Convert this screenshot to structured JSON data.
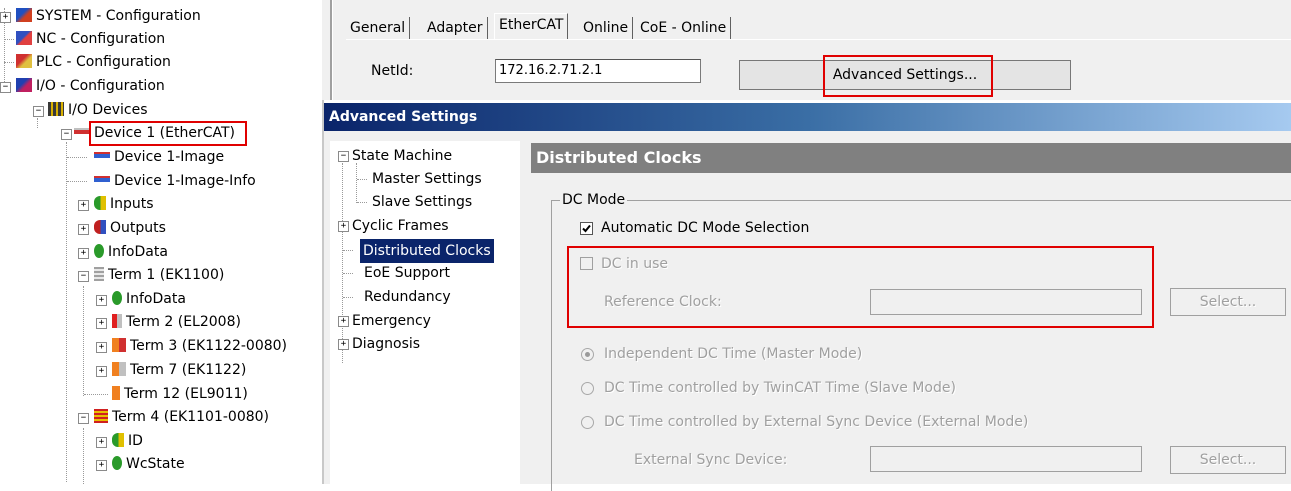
{
  "tree": {
    "items": [
      {
        "label": "SYSTEM - Configuration",
        "icon": "system-config-icon"
      },
      {
        "label": "NC - Configuration",
        "icon": "nc-config-icon"
      },
      {
        "label": "PLC - Configuration",
        "icon": "plc-config-icon"
      },
      {
        "label": "I/O - Configuration",
        "icon": "io-config-icon"
      },
      {
        "label": "I/O Devices",
        "icon": "io-devices-icon"
      },
      {
        "label": "Device 1 (EtherCAT)",
        "icon": "ethercat-device-icon"
      },
      {
        "label": "Device 1-Image",
        "icon": "image-icon"
      },
      {
        "label": "Device 1-Image-Info",
        "icon": "image-info-icon"
      },
      {
        "label": "Inputs",
        "icon": "inputs-icon"
      },
      {
        "label": "Outputs",
        "icon": "outputs-icon"
      },
      {
        "label": "InfoData",
        "icon": "infodata-icon"
      },
      {
        "label": "Term 1 (EK1100)",
        "icon": "terminal-icon"
      },
      {
        "label": "InfoData",
        "icon": "infodata-icon"
      },
      {
        "label": "Term 2 (EL2008)",
        "icon": "terminal-icon"
      },
      {
        "label": "Term 3 (EK1122-0080)",
        "icon": "terminal-icon"
      },
      {
        "label": "Term 7 (EK1122)",
        "icon": "terminal-icon"
      },
      {
        "label": "Term 12 (EL9011)",
        "icon": "terminal-icon"
      },
      {
        "label": "Term 4 (EK1101-0080)",
        "icon": "terminal-icon"
      },
      {
        "label": "ID",
        "icon": "id-icon"
      },
      {
        "label": "WcState",
        "icon": "wcstate-icon"
      }
    ]
  },
  "tabs": [
    "General",
    "Adapter",
    "EtherCAT",
    "Online",
    "CoE - Online"
  ],
  "active_tab": "EtherCAT",
  "netid": {
    "label": "NetId:",
    "value": "172.16.2.71.2.1"
  },
  "advanced_button": "Advanced Settings...",
  "dialog": {
    "title": "Advanced Settings",
    "nav": [
      {
        "label": "State Machine"
      },
      {
        "label": "Master Settings"
      },
      {
        "label": "Slave Settings"
      },
      {
        "label": "Cyclic Frames"
      },
      {
        "label": "Distributed Clocks"
      },
      {
        "label": "EoE Support"
      },
      {
        "label": "Redundancy"
      },
      {
        "label": "Emergency"
      },
      {
        "label": "Diagnosis"
      }
    ],
    "selected_nav": "Distributed Clocks",
    "section_title": "Distributed Clocks",
    "group_title": "DC Mode",
    "auto_dc_label": "Automatic DC Mode Selection",
    "auto_dc_checked": true,
    "dc_in_use_label": "DC in use",
    "dc_in_use_checked": false,
    "reference_clock_label": "Reference Clock:",
    "reference_clock_value": "",
    "select_label": "Select...",
    "radio_master": "Independent DC Time (Master Mode)",
    "radio_slave": "DC Time controlled by TwinCAT Time (Slave Mode)",
    "radio_external": "DC Time controlled by External Sync Device (External Mode)",
    "selected_radio": "Independent DC Time (Master Mode)",
    "external_sync_label": "External Sync Device:",
    "external_sync_value": ""
  },
  "colors": {
    "highlight_red": "#e00000",
    "selection_blue": "#0a246a",
    "title_gradient_start": "#0a246a",
    "title_gradient_end": "#a6caf0",
    "section_header_gray": "#808080"
  }
}
